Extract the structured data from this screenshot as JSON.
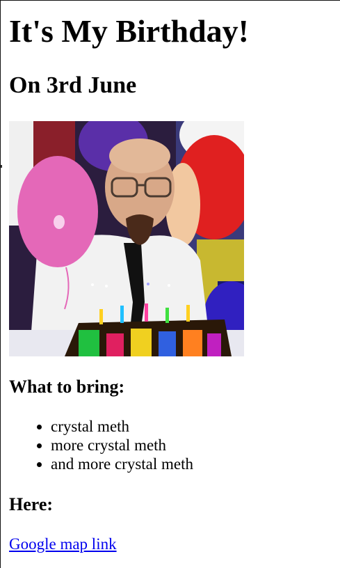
{
  "page": {
    "title": "It's My Birthday!",
    "date": "On 3rd June"
  },
  "image": {
    "icon": "birthday-party-photo"
  },
  "bring": {
    "heading": "What to bring:",
    "items": [
      "crystal meth",
      "more crystal meth",
      "and more crystal meth"
    ]
  },
  "location": {
    "heading": "Here:",
    "link_label": "Google map link"
  },
  "colors": {
    "link": "#0000ee",
    "text": "#000000",
    "background": "#ffffff"
  }
}
